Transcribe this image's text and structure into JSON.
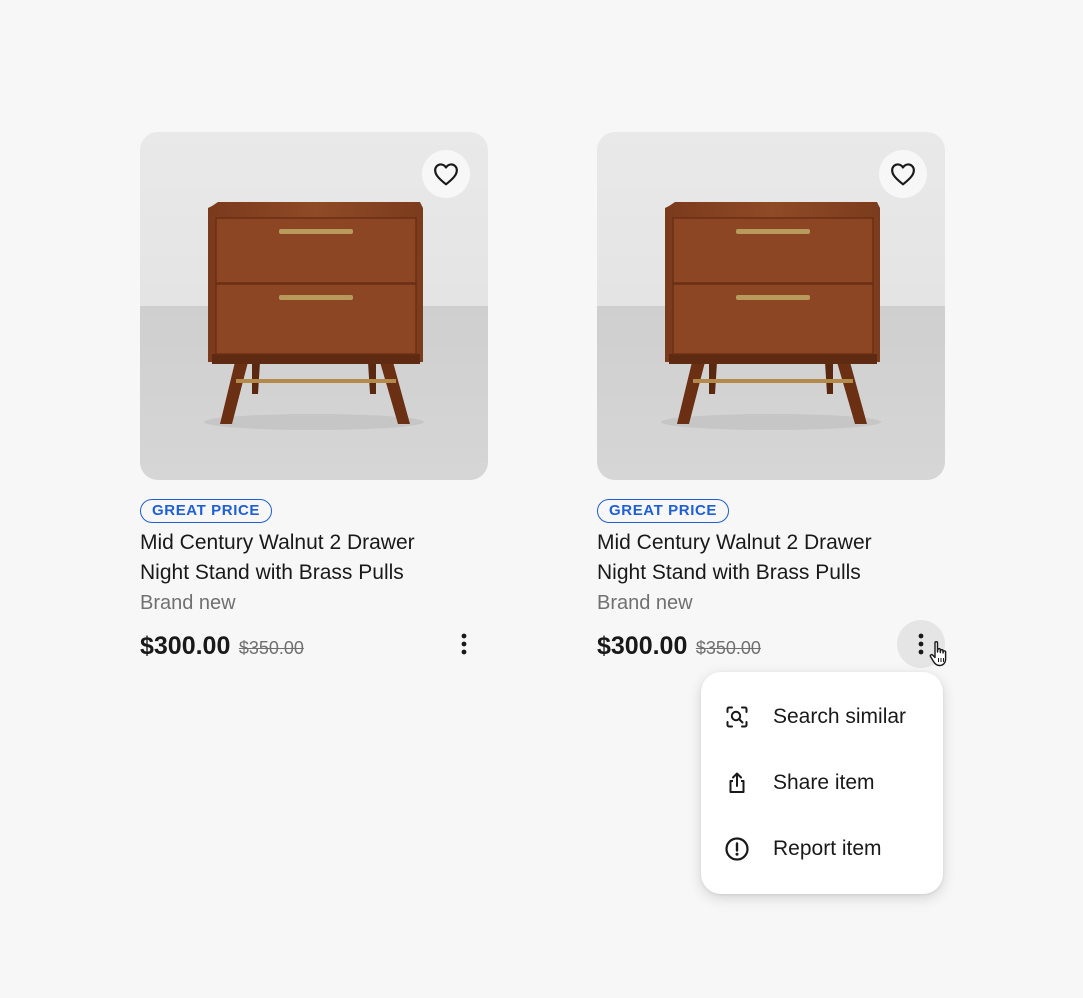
{
  "colors": {
    "accent": "#1f5fd6",
    "text": "#191919",
    "muted": "#707070",
    "background": "#f7f7f7"
  },
  "listings": [
    {
      "badge": "GREAT PRICE",
      "title": "Mid Century Walnut 2 Drawer Night Stand with Brass Pulls",
      "condition": "Brand new",
      "price": "$300.00",
      "original_price": "$350.00",
      "favorite_icon": "heart-outline-icon",
      "more_icon": "more-vertical-icon"
    },
    {
      "badge": "GREAT PRICE",
      "title": "Mid Century Walnut 2 Drawer Night Stand with Brass Pulls",
      "condition": "Brand new",
      "price": "$300.00",
      "original_price": "$350.00",
      "favorite_icon": "heart-outline-icon",
      "more_icon": "more-vertical-icon"
    }
  ],
  "context_menu": {
    "items": [
      {
        "label": "Search similar",
        "icon": "image-search-icon"
      },
      {
        "label": "Share item",
        "icon": "share-icon"
      },
      {
        "label": "Report item",
        "icon": "alert-circle-icon"
      }
    ]
  }
}
